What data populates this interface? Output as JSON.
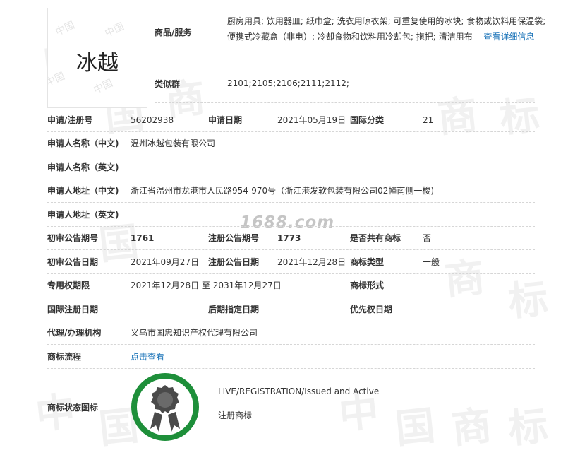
{
  "watermark": {
    "site": "1688.com",
    "background_chars": [
      "中",
      "国",
      "商",
      "标"
    ]
  },
  "mark_image": {
    "text": "冰越",
    "tile_watermark": "中国",
    "alt": "trademark-image"
  },
  "goods_services": {
    "label": "商品/服务",
    "line1": "厨房用具; 饮用器皿; 纸巾盒; 洗衣用晾衣架; 可重复使用的冰块; 食物或饮料用保温袋;",
    "line2": "便携式冷藏盒（非电）; 冷却食物和饮料用冷却包; 拖把; 清洁用布",
    "detail_link": "查看详细信息"
  },
  "similar_group": {
    "label": "类似群",
    "value": "2101;2105;2106;2111;2112;"
  },
  "rows": {
    "reg_no": {
      "label": "申请/注册号",
      "value": "56202938"
    },
    "apply_date": {
      "label": "申请日期",
      "value": "2021年05月19日"
    },
    "intl_class": {
      "label": "国际分类",
      "value": "21"
    },
    "applicant_cn": {
      "label": "申请人名称（中文)",
      "value": "温州冰越包装有限公司"
    },
    "applicant_en": {
      "label": "申请人名称（英文)",
      "value": ""
    },
    "address_cn": {
      "label": "申请人地址（中文)",
      "value": "浙江省温州市龙港市人民路954-970号（浙江港发软包装有限公司02幢南侧一楼)"
    },
    "address_en": {
      "label": "申请人地址（英文)",
      "value": ""
    },
    "prelim_no": {
      "label": "初审公告期号",
      "value": "1761"
    },
    "reg_pub_no": {
      "label": "注册公告期号",
      "value": "1773"
    },
    "shared": {
      "label": "是否共有商标",
      "value": "否"
    },
    "prelim_date": {
      "label": "初审公告日期",
      "value": "2021年09月27日"
    },
    "reg_pub_date": {
      "label": "注册公告日期",
      "value": "2021年12月28日"
    },
    "mark_type": {
      "label": "商标类型",
      "value": "一般"
    },
    "exclusive_period": {
      "label": "专用权期限",
      "value": "2021年12月28日 至 2031年12月27日"
    },
    "mark_form": {
      "label": "商标形式",
      "value": ""
    },
    "intl_reg_date": {
      "label": "国际注册日期",
      "value": ""
    },
    "later_designation": {
      "label": "后期指定日期",
      "value": ""
    },
    "priority_date": {
      "label": "优先权日期",
      "value": ""
    },
    "agent": {
      "label": "代理/办理机构",
      "value": "义乌市国忠知识产权代理有限公司"
    },
    "process": {
      "label": "商标流程",
      "value": "点击查看"
    }
  },
  "status": {
    "label": "商标状态图标",
    "english": "LIVE/REGISTRATION/Issued and Active",
    "chinese": "注册商标",
    "ring_color": "#1e8f3a",
    "icon": "award-ribbon-icon"
  },
  "colors": {
    "link": "#1a73b8",
    "text": "#333333",
    "divider": "#d6d6d6"
  }
}
